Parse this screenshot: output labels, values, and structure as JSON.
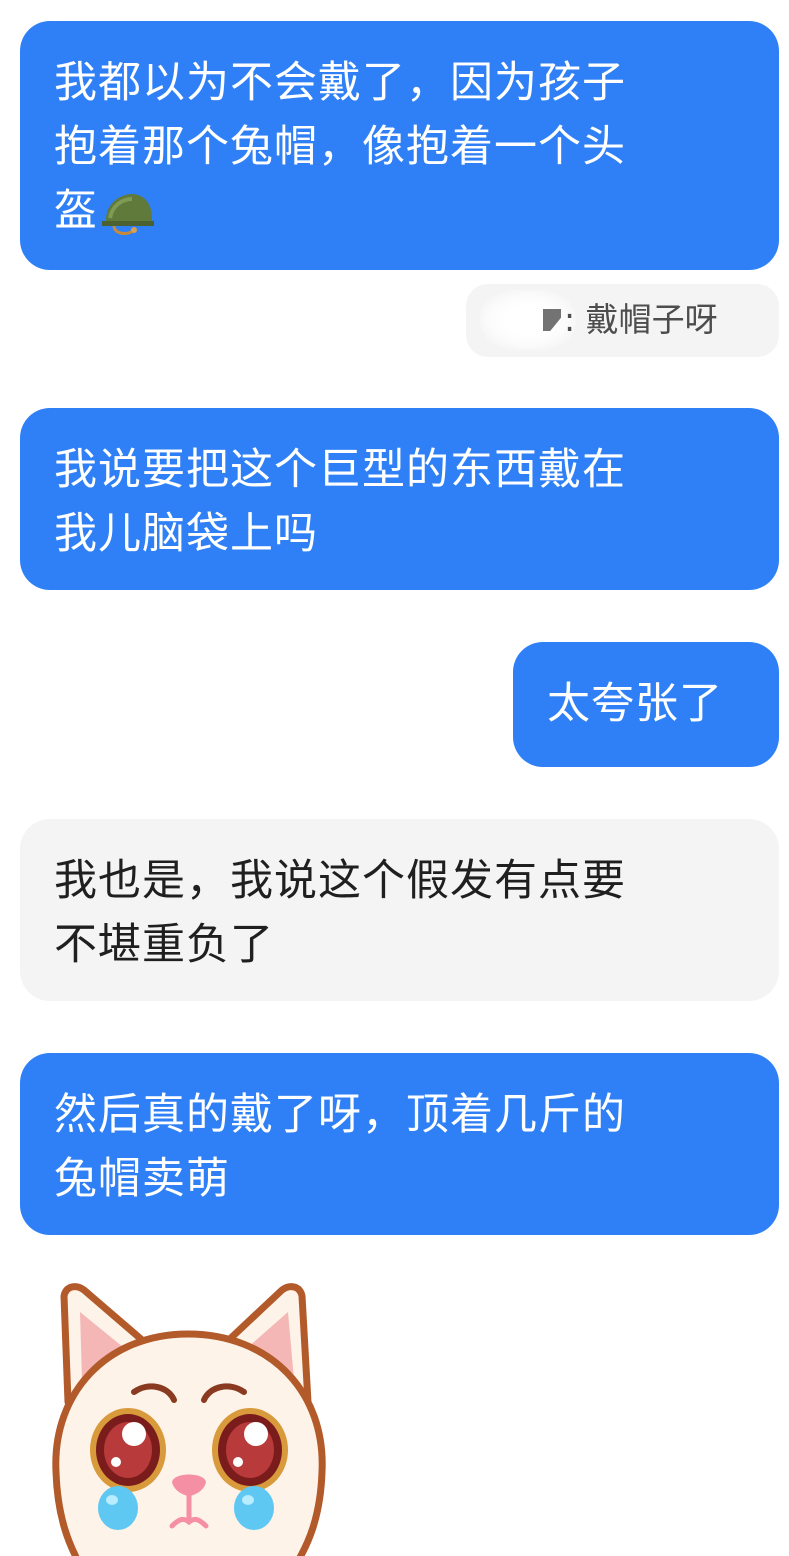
{
  "messages": [
    {
      "side": "right",
      "lines": [
        "我都以为不会戴了，因为孩子",
        "抱着那个兔帽，像抱着一个头",
        "盔"
      ],
      "emoji": "helmet-icon"
    },
    {
      "quote": {
        "text": ": 戴帽子呀"
      }
    },
    {
      "side": "right",
      "lines": [
        "我说要把这个巨型的东西戴在",
        "我儿脑袋上吗"
      ]
    },
    {
      "side": "right",
      "lines": [
        "太夸张了"
      ]
    },
    {
      "side": "left",
      "lines": [
        "我也是，我说这个假发有点要",
        "不堪重负了"
      ]
    },
    {
      "side": "right",
      "lines": [
        "然后真的戴了呀，顶着几斤的",
        "兔帽卖萌"
      ]
    },
    {
      "side": "left",
      "sticker": "crying-cat-sticker"
    }
  ],
  "colors": {
    "outgoing_bubble": "#2f80f7",
    "incoming_bubble": "#f4f4f4",
    "outgoing_text": "#ffffff",
    "incoming_text": "#1f1f1f"
  }
}
